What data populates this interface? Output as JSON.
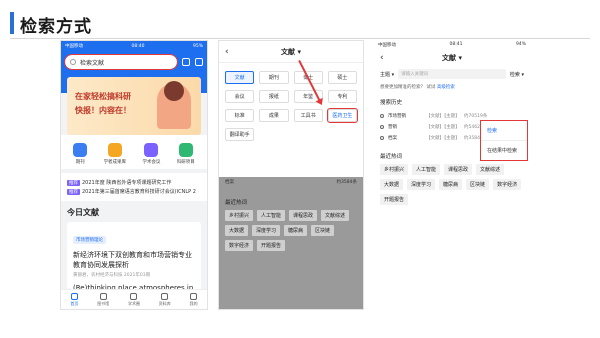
{
  "title": "检索方式",
  "phone1": {
    "status": {
      "carrier": "中国移动",
      "time": "08:40",
      "battery": "95%"
    },
    "search_placeholder": "检索文献",
    "banner": {
      "line1": "在家轻松搞科研",
      "line2": "快报！内容在！"
    },
    "icons": [
      {
        "label": "期刊",
        "color": "#3b7ef2"
      },
      {
        "label": "学者成果库",
        "color": "#f5a623"
      },
      {
        "label": "学术会议",
        "color": "#7b61ff"
      },
      {
        "label": "科研项目",
        "color": "#2eb872"
      }
    ],
    "news": [
      {
        "tag": "推荐",
        "text": "2021年度 陕西省外语专项课题研究工作"
      },
      {
        "tag": "推荐",
        "text": "2021年第三届首席语言教育科技研讨会议(ICNLP 2"
      }
    ],
    "today_title": "今日文献",
    "card": {
      "tag": "市场营销理论",
      "title": "新经济环境下双创教育和市场营销专业教育协同发展探析",
      "meta": "黄丽君，农村经济与科技 2021年03期",
      "title2": "(Re)thinking place atmospheres in marketing"
    },
    "tabs": [
      {
        "label": "首页",
        "active": true
      },
      {
        "label": "图书馆"
      },
      {
        "label": "学术圈"
      },
      {
        "label": "资料库"
      },
      {
        "label": "我的"
      }
    ]
  },
  "phone2": {
    "top_title": "文献 ▾",
    "back": "‹",
    "grid": [
      {
        "label": "文献",
        "state": "sel"
      },
      {
        "label": "期刊"
      },
      {
        "label": "博士"
      },
      {
        "label": "硕士"
      },
      {
        "label": "会议"
      },
      {
        "label": "报纸"
      },
      {
        "label": "年鉴"
      },
      {
        "label": "专利"
      },
      {
        "label": "标准"
      },
      {
        "label": "成果"
      },
      {
        "label": "工具书"
      },
      {
        "label": "医药卫生",
        "state": "hl"
      },
      {
        "label": "翻译助手"
      }
    ],
    "search_row": {
      "left": "档案",
      "right": "约3584条"
    },
    "hot_title": "最近热词",
    "chips": [
      "乡村振兴",
      "人工智能",
      "课程思政",
      "文献综述",
      "大数据",
      "深度学习",
      "糖尿病",
      "区块链",
      "数字经济",
      "开题报告"
    ]
  },
  "phone3": {
    "status": {
      "carrier": "中国移动",
      "time": "08:41",
      "battery": "94%"
    },
    "back": "‹",
    "top_title": "文献 ▾",
    "field": "主题 ▾",
    "input_placeholder": "请输入关键词",
    "option": "检索 ▾",
    "tip_text": "想要更加精准的检索？ 试试",
    "tip_link": "高级检索",
    "dropdown": [
      "检索",
      "在结果中检索"
    ],
    "history_title": "搜索历史",
    "history": [
      {
        "name": "市场营销",
        "type": "【文献】【主题】",
        "count": "约70519条"
      },
      {
        "name": "营销",
        "type": "【文献】【主题】",
        "count": "约546248条"
      },
      {
        "name": "档案",
        "type": "【文献】【主题】",
        "count": "约3584条"
      }
    ],
    "hot_title": "最近热词",
    "chips": [
      "乡村振兴",
      "人工智能",
      "课程思政",
      "文献综述",
      "大数据",
      "深度学习",
      "糖尿病",
      "区块链",
      "数字经济",
      "开题报告"
    ]
  }
}
